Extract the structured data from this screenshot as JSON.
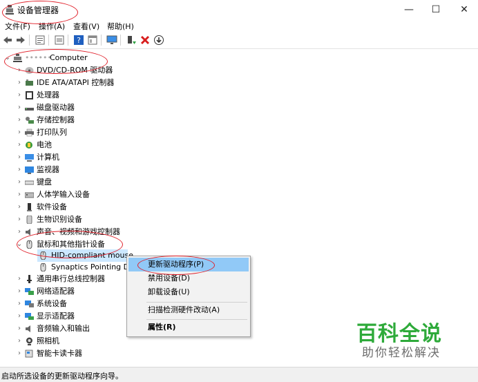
{
  "window": {
    "title": "设备管理器",
    "min_glyph": "—",
    "max_glyph": "☐",
    "close_glyph": "✕"
  },
  "menu": [
    "文件(F)",
    "操作(A)",
    "查看(V)",
    "帮助(H)"
  ],
  "toolbar_icons": [
    "back-arrow-icon",
    "forward-arrow-icon",
    "properties-icon",
    "device-list-icon",
    "help-icon",
    "view-icon",
    "monitor-icon",
    "update-driver-icon",
    "uninstall-x-icon",
    "download-icon"
  ],
  "tree": {
    "root": {
      "label": "Computer",
      "prefix_blurred": "••••••",
      "expanded": true
    },
    "categories": [
      {
        "label": "DVD/CD-ROM 驱动器",
        "icon": "disc-drive-icon",
        "expanded": false
      },
      {
        "label": "IDE ATA/ATAPI 控制器",
        "icon": "ide-controller-icon",
        "expanded": false
      },
      {
        "label": "处理器",
        "icon": "processor-icon",
        "expanded": false
      },
      {
        "label": "磁盘驱动器",
        "icon": "disk-drive-icon",
        "expanded": false
      },
      {
        "label": "存储控制器",
        "icon": "storage-controller-icon",
        "expanded": false
      },
      {
        "label": "打印队列",
        "icon": "printer-icon",
        "expanded": false
      },
      {
        "label": "电池",
        "icon": "battery-icon",
        "expanded": false
      },
      {
        "label": "计算机",
        "icon": "computer-icon",
        "expanded": false
      },
      {
        "label": "监视器",
        "icon": "monitor-icon",
        "expanded": false
      },
      {
        "label": "键盘",
        "icon": "keyboard-icon",
        "expanded": false
      },
      {
        "label": "人体学输入设备",
        "icon": "hid-icon",
        "expanded": false
      },
      {
        "label": "软件设备",
        "icon": "software-device-icon",
        "expanded": false
      },
      {
        "label": "生物识别设备",
        "icon": "biometric-icon",
        "expanded": false
      },
      {
        "label": "声音、视频和游戏控制器",
        "icon": "sound-icon",
        "expanded": false
      },
      {
        "label": "鼠标和其他指针设备",
        "icon": "mouse-icon",
        "expanded": true,
        "children": [
          {
            "label": "HID-compliant mouse",
            "icon": "mouse-icon",
            "selected": true
          },
          {
            "label": "Synaptics Pointing De",
            "icon": "mouse-icon",
            "selected": false
          }
        ]
      },
      {
        "label": "通用串行总线控制器",
        "icon": "usb-icon",
        "expanded": false
      },
      {
        "label": "网络适配器",
        "icon": "network-adapter-icon",
        "expanded": false
      },
      {
        "label": "系统设备",
        "icon": "system-device-icon",
        "expanded": false
      },
      {
        "label": "显示适配器",
        "icon": "display-adapter-icon",
        "expanded": false
      },
      {
        "label": "音频输入和输出",
        "icon": "audio-io-icon",
        "expanded": false
      },
      {
        "label": "照相机",
        "icon": "camera-icon",
        "expanded": false
      },
      {
        "label": "智能卡读卡器",
        "icon": "smartcard-reader-icon",
        "expanded": false
      }
    ]
  },
  "context_menu": {
    "items": [
      {
        "label": "更新驱动程序(P)",
        "highlighted": true
      },
      {
        "label": "禁用设备(D)",
        "highlighted": false
      },
      {
        "label": "卸载设备(U)",
        "highlighted": false
      },
      {
        "label": "扫描检测硬件改动(A)",
        "highlighted": false
      },
      {
        "label": "属性(R)",
        "highlighted": false,
        "bold": true
      }
    ]
  },
  "status": {
    "text": "启动所选设备的更新驱动程序向导。"
  },
  "watermark": {
    "main": "百科全说",
    "sub": "助你轻松解决",
    "main_color": "#2eaa3a"
  },
  "colors": {
    "annotation": "#e0202a",
    "selection": "#cce8ff",
    "menu_highlight": "#91c9f7"
  }
}
